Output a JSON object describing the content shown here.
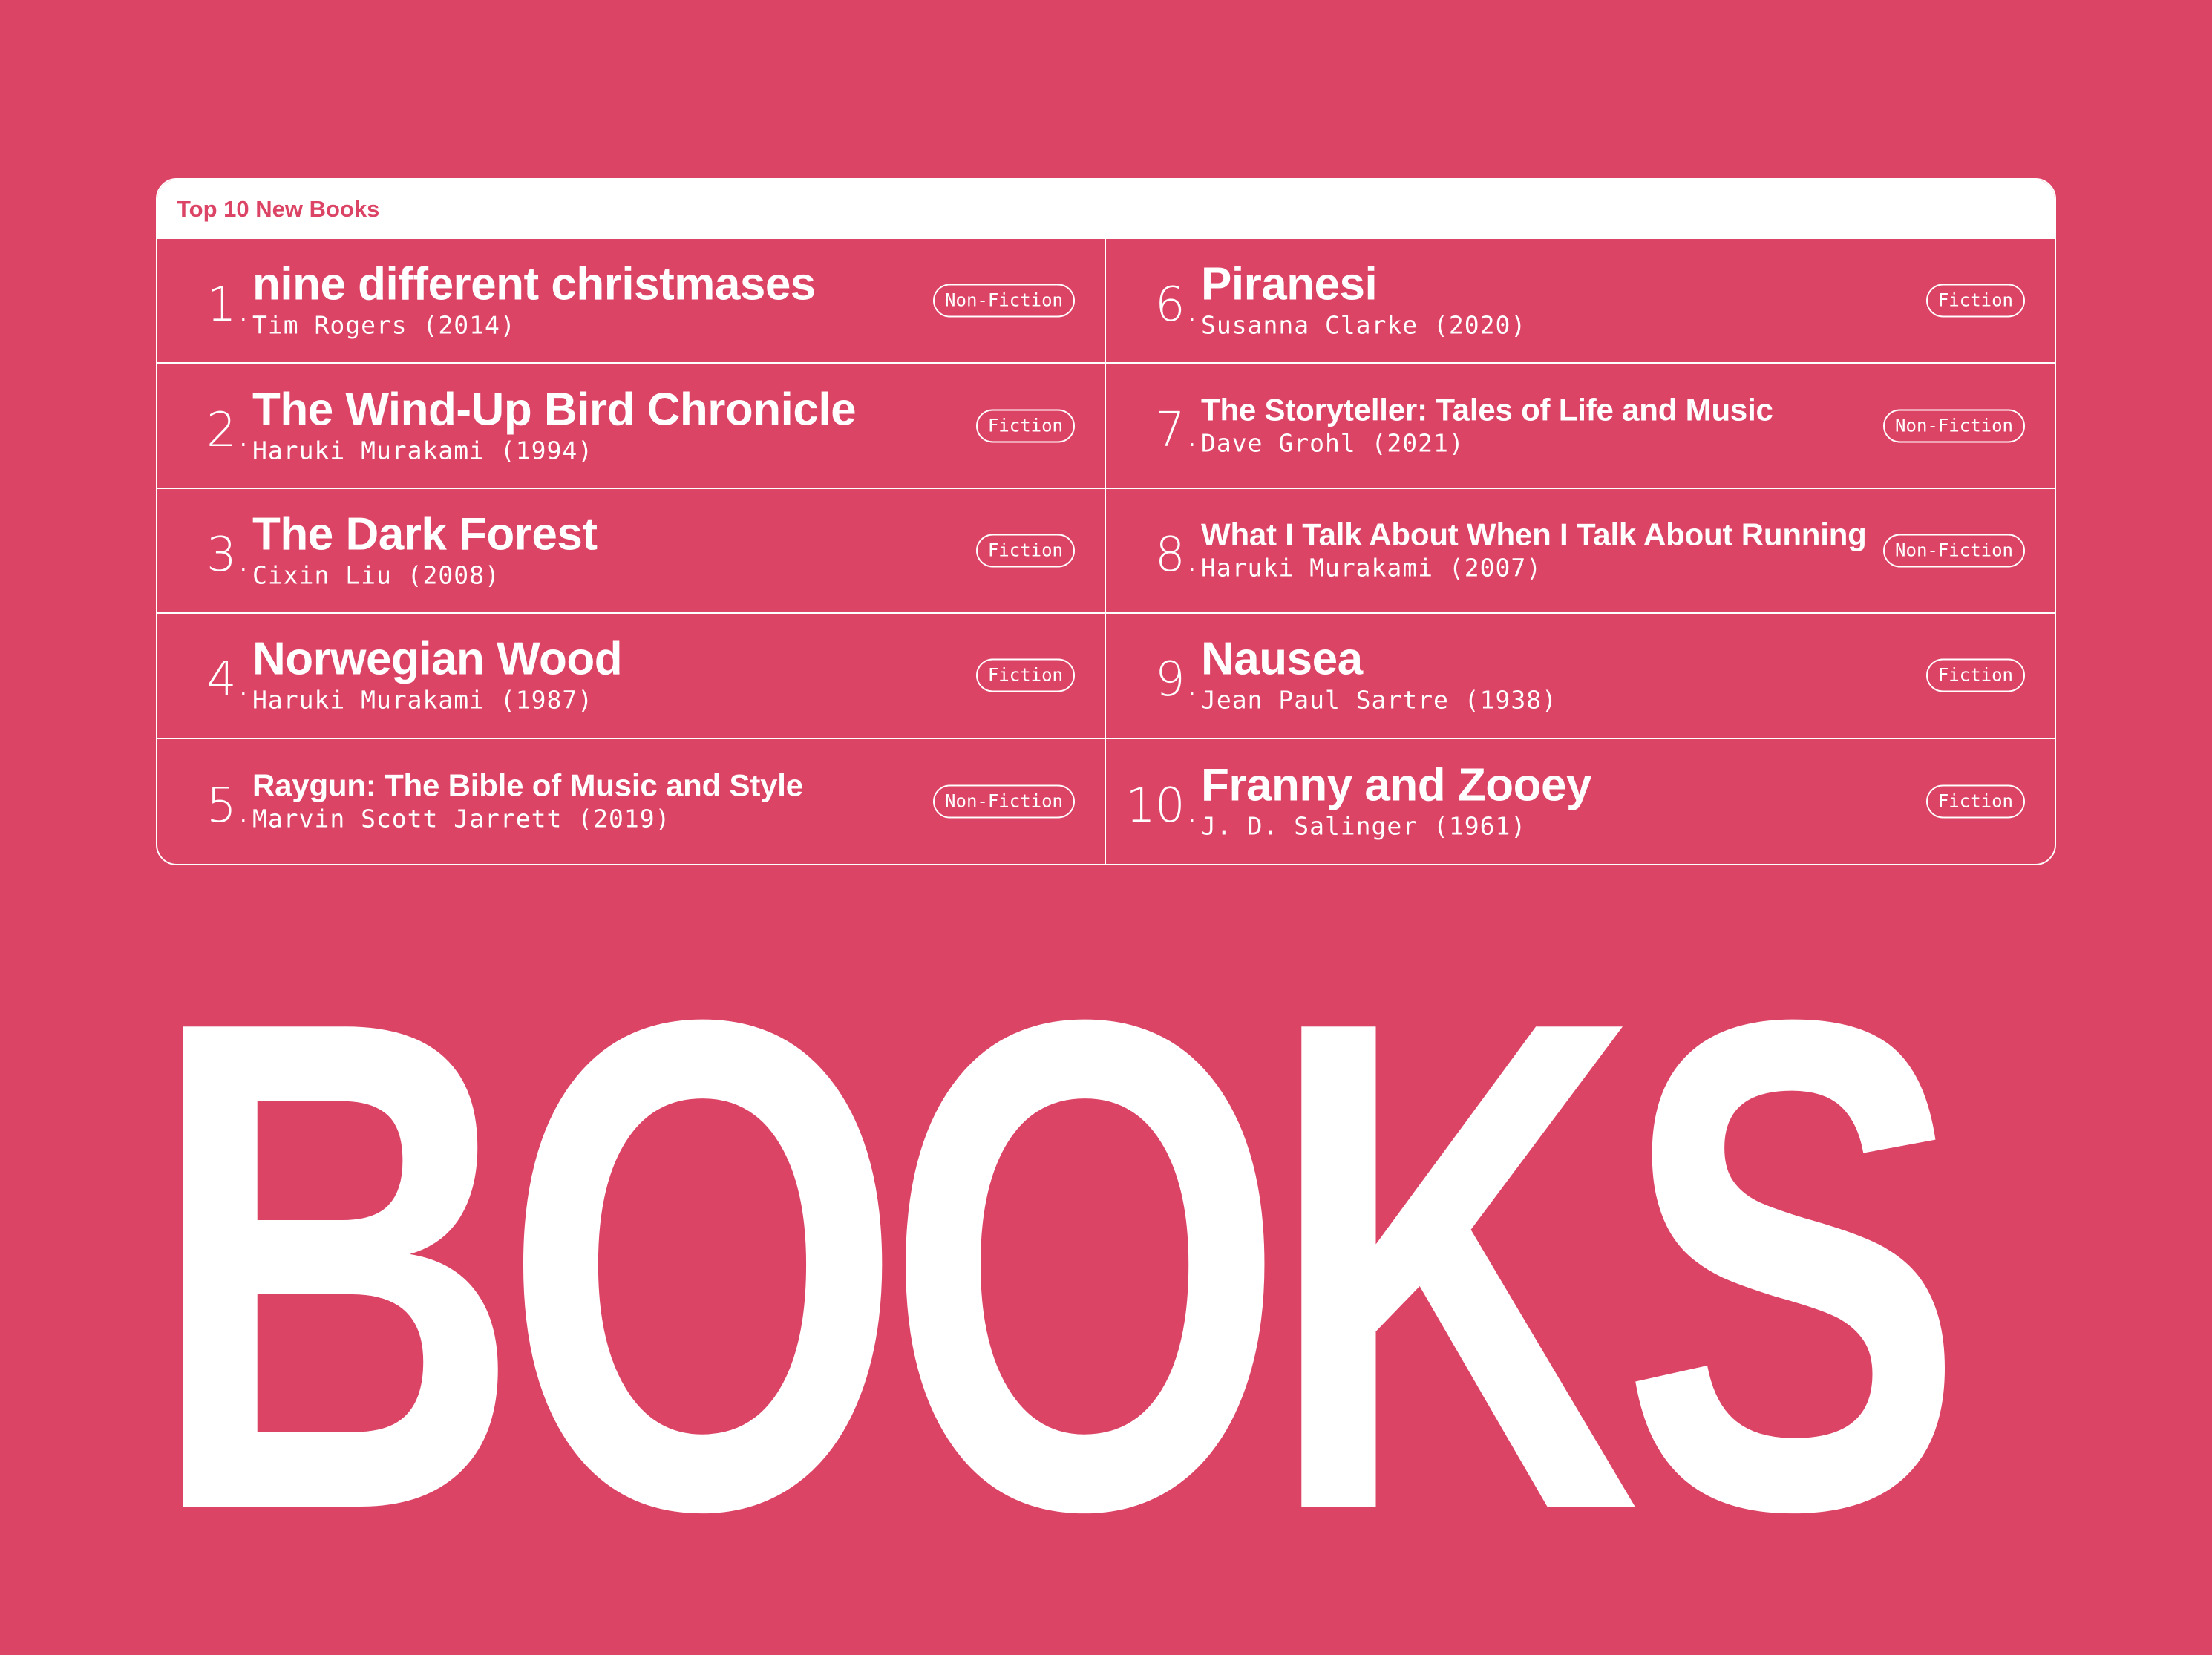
{
  "panel": {
    "header_title": "Top 10 New Books"
  },
  "books": [
    {
      "rank": "1.",
      "title": "nine different christmases",
      "author_year": "Tim Rogers (2014)",
      "genre": "Non-Fiction",
      "size": "large"
    },
    {
      "rank": "2.",
      "title": "The Wind-Up Bird Chronicle",
      "author_year": "Haruki Murakami (1994)",
      "genre": "Fiction",
      "size": "large"
    },
    {
      "rank": "3.",
      "title": "The Dark Forest",
      "author_year": "Cixin Liu (2008)",
      "genre": "Fiction",
      "size": "large"
    },
    {
      "rank": "4.",
      "title": "Norwegian Wood",
      "author_year": "Haruki Murakami (1987)",
      "genre": "Fiction",
      "size": "large"
    },
    {
      "rank": "5.",
      "title": "Raygun: The Bible of Music and Style",
      "author_year": "Marvin Scott Jarrett (2019)",
      "genre": "Non-Fiction",
      "size": "small"
    },
    {
      "rank": "6.",
      "title": "Piranesi",
      "author_year": "Susanna Clarke (2020)",
      "genre": "Fiction",
      "size": "large"
    },
    {
      "rank": "7.",
      "title": "The Storyteller: Tales of Life and Music",
      "author_year": "Dave Grohl (2021)",
      "genre": "Non-Fiction",
      "size": "small"
    },
    {
      "rank": "8.",
      "title": "What I Talk About When I Talk About Running",
      "author_year": "Haruki Murakami (2007)",
      "genre": "Non-Fiction",
      "size": "small"
    },
    {
      "rank": "9.",
      "title": "Nausea",
      "author_year": "Jean Paul Sartre (1938)",
      "genre": "Fiction",
      "size": "large"
    },
    {
      "rank": "10.",
      "title": "Franny and Zooey",
      "author_year": "J. D. Salinger (1961)",
      "genre": "Fiction",
      "size": "large"
    }
  ],
  "hero": {
    "word": "BOOKS"
  },
  "colors": {
    "background": "#DC4466",
    "foreground": "#FFFFFF"
  }
}
